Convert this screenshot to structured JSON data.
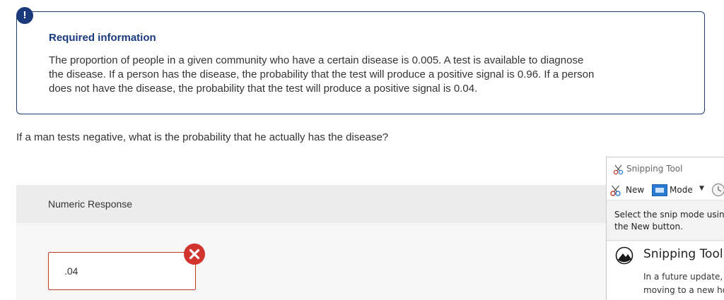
{
  "alert": {
    "symbol": "!"
  },
  "info": {
    "title": "Required information",
    "lines": [
      "The proportion of people in a given community who have a certain disease is 0.005. A test is available to diagnose",
      "the disease. If a person has the disease, the probability that the test will produce a positive signal is 0.96. If a person",
      "does not have the disease, the probability that the test will produce a positive signal is 0.04."
    ]
  },
  "question": "If a man tests negative, what is the probability that he actually has the disease?",
  "response": {
    "label": "Numeric Response",
    "value": ".04",
    "status": "incorrect"
  },
  "colors": {
    "brand_navy": "#1a3a7c",
    "error_red": "#d0342c",
    "band_gray": "#ececec"
  },
  "snipping_tool": {
    "title": "Snipping Tool",
    "new_label": "New",
    "mode_label": "Mode",
    "message_lines": [
      "Select the snip mode using",
      "the New button."
    ],
    "notice_heading": "Snipping Tool i",
    "notice_lines": [
      "In a future update, S",
      "moving to a new ho"
    ]
  }
}
